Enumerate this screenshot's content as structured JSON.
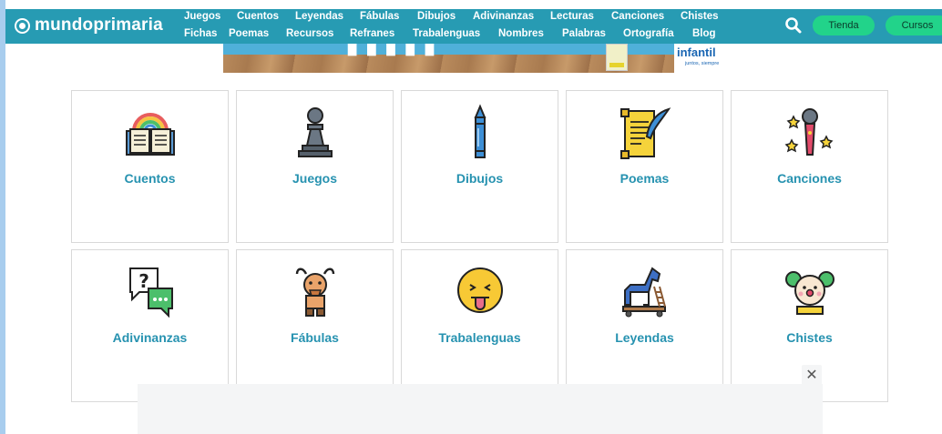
{
  "brand": {
    "name": "mundoprimaria"
  },
  "nav": {
    "row1": [
      "Juegos",
      "Cuentos",
      "Leyendas",
      "Fábulas",
      "Dibujos",
      "Adivinanzas",
      "Lecturas",
      "Canciones",
      "Chistes"
    ],
    "row2": [
      "Fichas",
      "Poemas",
      "Recursos",
      "Refranes",
      "Trabalenguas",
      "Nombres",
      "Palabras",
      "Ortografía",
      "Blog"
    ]
  },
  "header_buttons": {
    "tienda": "Tienda",
    "cursos": "Cursos"
  },
  "banner": {
    "brand_text": "infantil",
    "brand_tagline": "juntos, siempre"
  },
  "cards": [
    {
      "label": "Cuentos",
      "icon": "book-rainbow-icon"
    },
    {
      "label": "Juegos",
      "icon": "chess-pawn-icon"
    },
    {
      "label": "Dibujos",
      "icon": "crayon-icon"
    },
    {
      "label": "Poemas",
      "icon": "scroll-quill-icon"
    },
    {
      "label": "Canciones",
      "icon": "microphone-stars-icon"
    },
    {
      "label": "Adivinanzas",
      "icon": "question-chat-icon"
    },
    {
      "label": "Fábulas",
      "icon": "faun-icon"
    },
    {
      "label": "Trabalenguas",
      "icon": "tongue-face-icon"
    },
    {
      "label": "Leyendas",
      "icon": "trojan-horse-icon"
    },
    {
      "label": "Chistes",
      "icon": "clown-icon"
    }
  ],
  "ad": {
    "close_symbol": "✕"
  },
  "colors": {
    "header": "#279bb3",
    "accent_text": "#2692b0",
    "pill": "#22d38a",
    "frame": "#a8cdee"
  }
}
